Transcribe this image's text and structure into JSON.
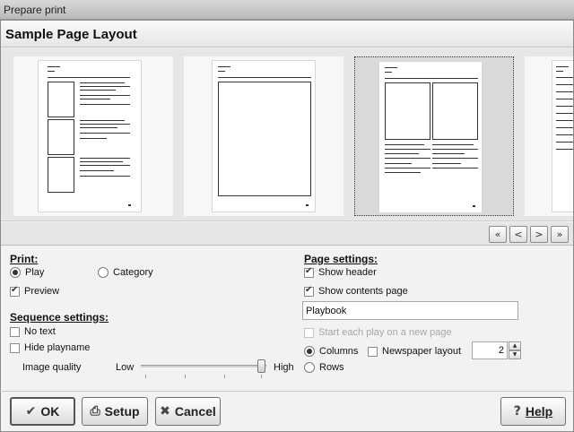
{
  "window": {
    "title": "Prepare print"
  },
  "header": {
    "title": "Sample Page Layout"
  },
  "pager": {
    "first": "«",
    "prev": "<",
    "next": ">",
    "last": "»"
  },
  "print": {
    "heading": "Print:",
    "play_label": "Play",
    "category_label": "Category",
    "preview_label": "Preview"
  },
  "sequence": {
    "heading": "Sequence settings:",
    "no_text_label": "No text",
    "hide_playname_label": "Hide playname",
    "image_quality_label": "Image quality",
    "low_label": "Low",
    "high_label": "High",
    "image_quality_level": 1.0
  },
  "page_settings": {
    "heading": "Page settings:",
    "show_header_label": "Show header",
    "show_contents_label": "Show contents page",
    "contents_title_value": "Playbook",
    "start_each_play_label": "Start each play on a new page",
    "columns_label": "Columns",
    "rows_label": "Rows",
    "newspaper_label": "Newspaper layout",
    "columns_value": "2"
  },
  "buttons": {
    "ok": "OK",
    "setup": "Setup",
    "cancel": "Cancel",
    "help": "Help"
  },
  "icons": {
    "ok": "checkmark-icon",
    "setup": "printer-icon",
    "cancel": "cross-icon",
    "help": "help-icon"
  }
}
